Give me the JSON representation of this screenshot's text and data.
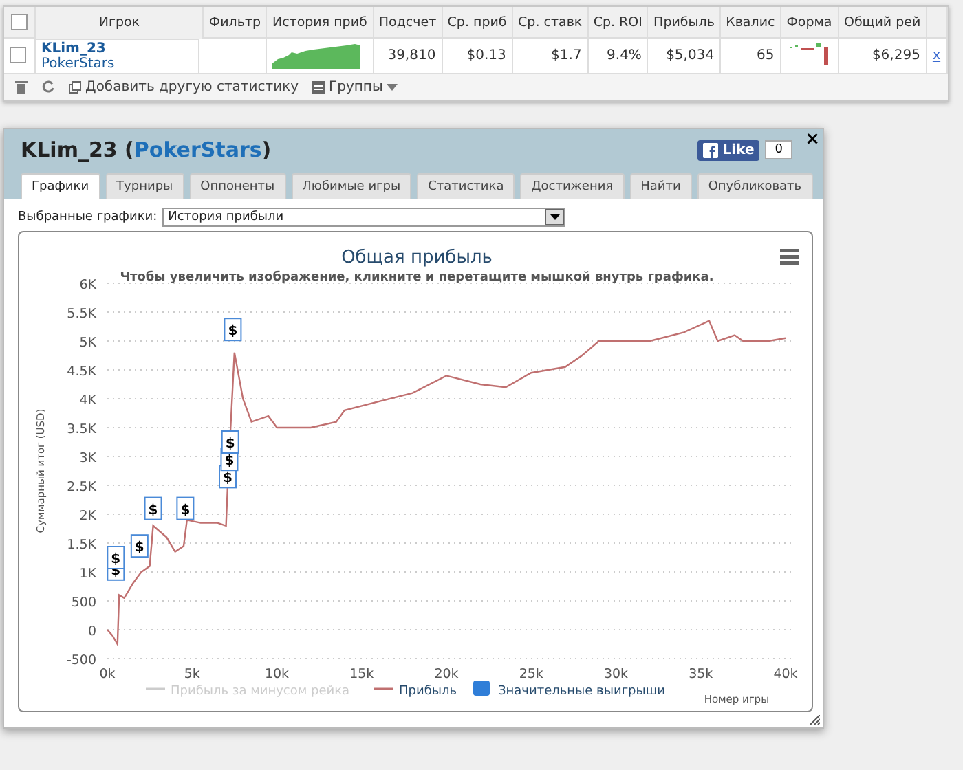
{
  "stats_table": {
    "select_all_checked": false,
    "columns": [
      "Игрок",
      "Фильтр",
      "История приб",
      "Подсчет",
      "Ср. приб",
      "Ср. ставк",
      "Ср. ROI",
      "Прибыль",
      "Квалис",
      "Форма",
      "Общий рей"
    ],
    "rows": [
      {
        "selected": false,
        "player": "KLim_23",
        "site": "PokerStars",
        "count": "39,810",
        "avg_profit": "$0.13",
        "avg_stake": "$1.7",
        "roi": "9.4%",
        "profit": "$5,034",
        "quali": "65",
        "total_rake": "$6,295",
        "remove": "x"
      }
    ],
    "toolbar": {
      "add_stat": "Добавить другую статистику",
      "groups": "Группы"
    }
  },
  "dialog": {
    "title_player": "KLim_23 (",
    "title_site": "PokerStars",
    "title_end": ")",
    "close": "×",
    "like": {
      "label": "Like",
      "count": "0"
    },
    "tabs": [
      {
        "label": "Графики",
        "selected": true
      },
      {
        "label": "Турниры",
        "selected": false
      },
      {
        "label": "Оппоненты",
        "selected": false
      },
      {
        "label": "Любимые игры",
        "selected": false
      },
      {
        "label": "Статистика",
        "selected": false
      },
      {
        "label": "Достижения",
        "selected": false
      },
      {
        "label": "Найти",
        "selected": false
      },
      {
        "label": "Опубликовать",
        "selected": false
      }
    ],
    "chart_select": {
      "label": "Выбранные графики:",
      "value": "История прибыли"
    },
    "chart_data": {
      "type": "line",
      "title": "Общая прибыль",
      "subtitle": "Чтобы увеличить изображение, кликните и перетащите мышкой внутрь графика.",
      "xlabel": "Номер игры",
      "ylabel": "Суммарный итог (USD)",
      "grid": true,
      "xlim": [
        0,
        40000
      ],
      "ylim": [
        -500,
        6000
      ],
      "xticks": [
        {
          "value": 0,
          "label": "0k"
        },
        {
          "value": 5000,
          "label": "5k"
        },
        {
          "value": 10000,
          "label": "10k"
        },
        {
          "value": 15000,
          "label": "15k"
        },
        {
          "value": 20000,
          "label": "20k"
        },
        {
          "value": 25000,
          "label": "25k"
        },
        {
          "value": 30000,
          "label": "30k"
        },
        {
          "value": 35000,
          "label": "35k"
        },
        {
          "value": 40000,
          "label": "40k"
        }
      ],
      "yticks": [
        {
          "value": -500,
          "label": "-500"
        },
        {
          "value": 0,
          "label": "0"
        },
        {
          "value": 500,
          "label": "500"
        },
        {
          "value": 1000,
          "label": "1K"
        },
        {
          "value": 1500,
          "label": "1.5K"
        },
        {
          "value": 2000,
          "label": "2K"
        },
        {
          "value": 2500,
          "label": "2.5K"
        },
        {
          "value": 3000,
          "label": "3K"
        },
        {
          "value": 3500,
          "label": "3.5K"
        },
        {
          "value": 4000,
          "label": "4K"
        },
        {
          "value": 4500,
          "label": "4.5K"
        },
        {
          "value": 5000,
          "label": "5K"
        },
        {
          "value": 5500,
          "label": "5.5K"
        },
        {
          "value": 6000,
          "label": "6K"
        }
      ],
      "x": [
        0,
        300,
        600,
        700,
        1000,
        1500,
        2000,
        2500,
        2700,
        3500,
        4000,
        4500,
        4700,
        5500,
        6500,
        7000,
        7100,
        7500,
        8000,
        8500,
        9500,
        10000,
        12000,
        13500,
        14000,
        16000,
        18000,
        20000,
        22000,
        23500,
        25000,
        27000,
        28000,
        29000,
        32000,
        34000,
        35500,
        36000,
        37000,
        37500,
        39000,
        40000
      ],
      "series": [
        {
          "name": "Прибыль",
          "color": "#c07070",
          "values": [
            0,
            -100,
            -250,
            600,
            550,
            800,
            1000,
            1100,
            1800,
            1600,
            1350,
            1450,
            1900,
            1850,
            1850,
            1800,
            2500,
            4800,
            4000,
            3600,
            3700,
            3500,
            3500,
            3600,
            3800,
            3950,
            4100,
            4400,
            4250,
            4200,
            4450,
            4550,
            4750,
            5000,
            5000,
            5150,
            5350,
            5000,
            5100,
            5000,
            5000,
            5050
          ]
        }
      ],
      "annotations": [
        {
          "x": 500,
          "y": 1050,
          "text": "$"
        },
        {
          "x": 500,
          "y": 1250,
          "text": "$"
        },
        {
          "x": 1900,
          "y": 1450,
          "text": "$"
        },
        {
          "x": 2700,
          "y": 2100,
          "text": "$"
        },
        {
          "x": 4600,
          "y": 2100,
          "text": "$"
        },
        {
          "x": 7100,
          "y": 2650,
          "text": "$"
        },
        {
          "x": 7200,
          "y": 2950,
          "text": "$"
        },
        {
          "x": 7250,
          "y": 3250,
          "text": "$"
        },
        {
          "x": 7400,
          "y": 5200,
          "text": "$"
        }
      ],
      "legend": [
        {
          "label": "Прибыль за минусом рейка",
          "kind": "line",
          "enabled": false,
          "color": "#cccccc"
        },
        {
          "kind": "series",
          "enabled": true
        },
        {
          "label": "Значительные выигрыши",
          "kind": "square",
          "enabled": true,
          "color": "#2f7ed8"
        }
      ]
    }
  }
}
